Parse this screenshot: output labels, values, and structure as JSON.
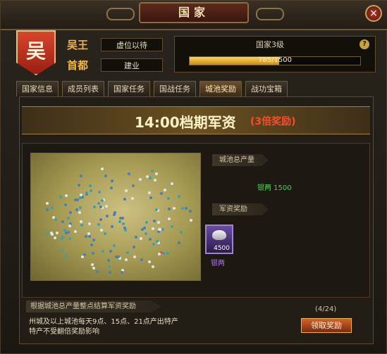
{
  "window": {
    "title": "国家",
    "close_label": "×"
  },
  "country": {
    "emblem_char": "吴",
    "king_label": "吴王",
    "king_value": "虚位以待",
    "capital_label": "首都",
    "capital_value": "建业"
  },
  "rank": {
    "label": "国家3级",
    "help": "?",
    "progress_text": "785/1500",
    "progress_fraction": 0.523
  },
  "tabs": [
    {
      "label": "国家信息"
    },
    {
      "label": "成员列表"
    },
    {
      "label": "国家任务"
    },
    {
      "label": "国战任务"
    },
    {
      "label": "城池奖励",
      "active": true
    },
    {
      "label": "战功宝箱"
    }
  ],
  "banner": {
    "title": "14:00档期军资",
    "bonus": "(3倍奖励)"
  },
  "output": {
    "label": "城池总产量",
    "value": "银两 1500"
  },
  "reward": {
    "label": "军资奖励",
    "count": "4500",
    "name": "银两"
  },
  "footer": {
    "tag": "根据城池总产量整点结算军资奖励",
    "desc_line1": "州城及以上城池每天9点、15点、21点产出特产",
    "desc_line2": "特产不受翻倍奖励影响",
    "count": "(4/24)",
    "claim_label": "领取奖励"
  },
  "colors": {
    "accent": "#f2b63b",
    "bonus": "#ff4a2a",
    "output": "#46d24a",
    "item_name": "#b46cff"
  }
}
